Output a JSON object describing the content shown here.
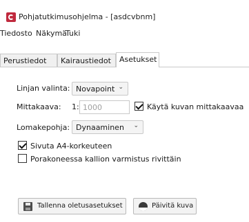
{
  "window": {
    "title": "Pohjatutkimusohjelma - [asdcvbnm]",
    "icon": "app-logo-icon"
  },
  "menu": {
    "items": [
      "Tiedosto",
      "Näkymä",
      "Tuki"
    ]
  },
  "tabs": {
    "items": [
      "Perustiedot",
      "Kairaustiedot",
      "Asetukset"
    ],
    "active": "Asetukset"
  },
  "settings": {
    "line_label": "Linjan valinta:",
    "line_value": "Novapoint",
    "scale_label": "Mittakaava:",
    "scale_prefix": "1:",
    "scale_placeholder": "1000",
    "use_image_scale_label": "Käytä kuvan mittakaavaa",
    "use_image_scale_checked": true,
    "template_label": "Lomakepohja:",
    "template_value": "Dynaaminen",
    "paginate_a4_label": "Sivuta A4-korkeuteen",
    "paginate_a4_checked": true,
    "rock_verification_label": "Porakoneessa kallion varmistus rivittäin",
    "rock_verification_checked": false
  },
  "buttons": {
    "save_defaults": "Tallenna oletusasetukset",
    "refresh_image": "Päivitä kuva"
  },
  "colors": {
    "app_icon": "#c02a3e",
    "tab_border": "#c9c9c9",
    "button_bg": "#f3f3f3"
  }
}
